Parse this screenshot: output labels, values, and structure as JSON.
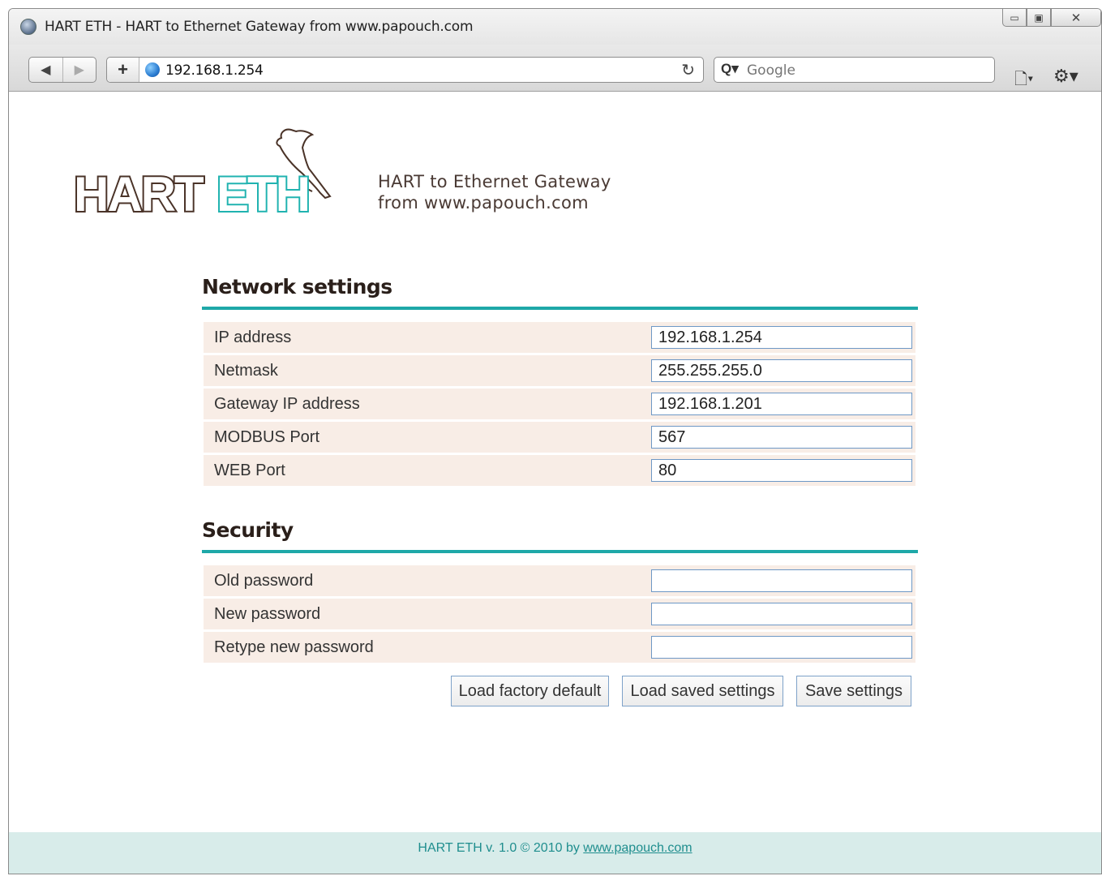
{
  "window": {
    "title": "HART ETH - HART to Ethernet Gateway from www.papouch.com"
  },
  "toolbar": {
    "address": "192.168.1.254",
    "search_placeholder": "Google"
  },
  "header": {
    "logo_word_1": "HART",
    "logo_word_2": "ETH",
    "tagline_line1": "HART to Ethernet Gateway",
    "tagline_line2": "from www.papouch.com"
  },
  "network": {
    "title": "Network settings",
    "rows": [
      {
        "label": "IP address",
        "value": "192.168.1.254"
      },
      {
        "label": "Netmask",
        "value": "255.255.255.0"
      },
      {
        "label": "Gateway IP address",
        "value": "192.168.1.201"
      },
      {
        "label": "MODBUS Port",
        "value": "567"
      },
      {
        "label": "WEB Port",
        "value": "80"
      }
    ]
  },
  "security": {
    "title": "Security",
    "rows": [
      {
        "label": "Old password",
        "value": ""
      },
      {
        "label": "New password",
        "value": ""
      },
      {
        "label": "Retype new password",
        "value": ""
      }
    ]
  },
  "actions": {
    "load_factory": "Load factory default",
    "load_saved": "Load saved settings",
    "save": "Save settings"
  },
  "footer": {
    "text": "HART ETH v. 1.0 © 2010 by ",
    "link": "www.papouch.com"
  },
  "colors": {
    "accent": "#1ea8a8",
    "row_bg": "#f8ede6",
    "logo_brown": "#4a3328",
    "footer_bg": "#d8ecea"
  }
}
